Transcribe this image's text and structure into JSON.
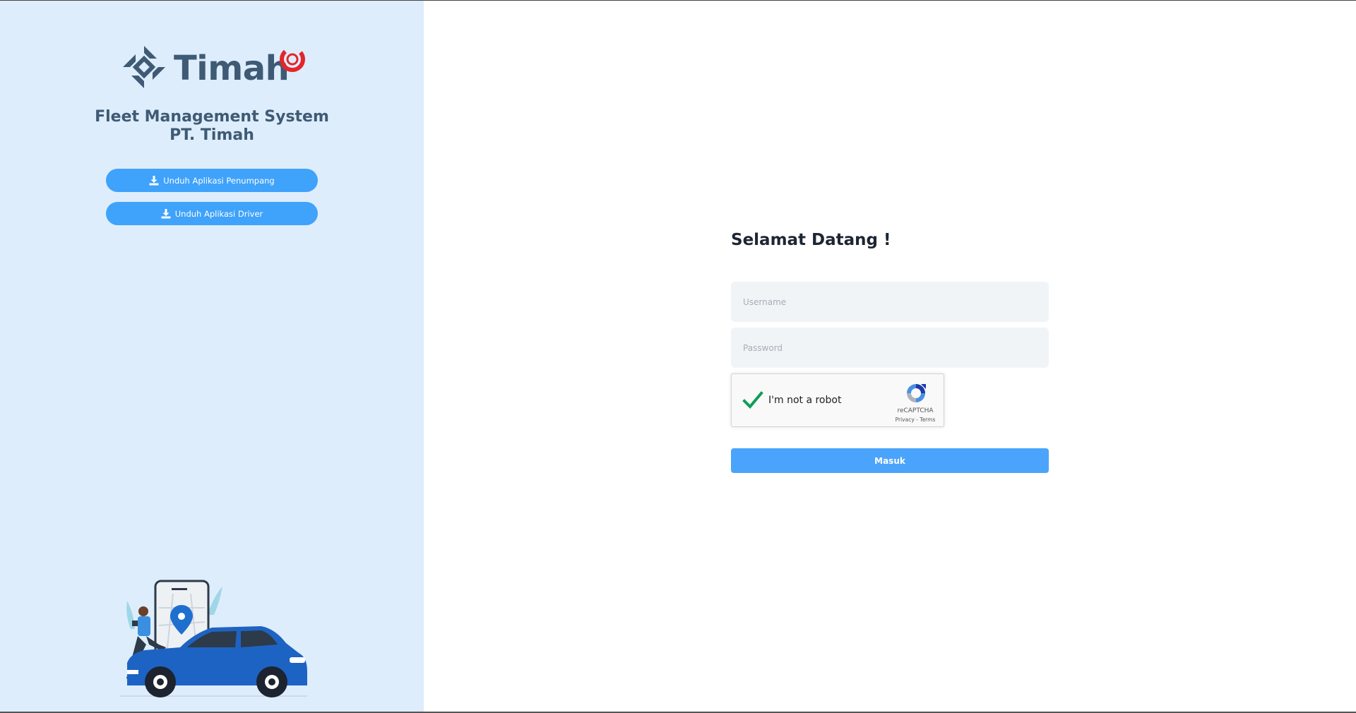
{
  "branding": {
    "logo_text": "Timah",
    "title_line1": "Fleet Management System",
    "title_line2": "PT. Timah"
  },
  "downloads": {
    "passenger_label": "Unduh Aplikasi Penumpang",
    "driver_label": "Unduh Aplikasi Driver"
  },
  "login": {
    "welcome": "Selamat Datang !",
    "username_placeholder": "Username",
    "username_value": "",
    "password_placeholder": "Password",
    "password_value": "",
    "submit_label": "Masuk"
  },
  "recaptcha": {
    "checked": true,
    "label": "I'm not a robot",
    "brand": "reCAPTCHA",
    "privacy": "Privacy",
    "separator": " - ",
    "terms": "Terms"
  },
  "colors": {
    "left_panel_bg": "#deedfc",
    "brand_text": "#3f5a74",
    "button_blue": "#3fa2fb",
    "brand_accent_red": "#e3262b",
    "check_green": "#0f9d58"
  },
  "icons": {
    "download": "download-icon",
    "check": "check-icon",
    "recaptcha_logo": "recaptcha-logo-icon"
  }
}
